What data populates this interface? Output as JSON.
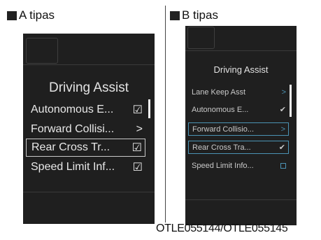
{
  "labels": {
    "a": "A tipas",
    "b": "B tipas"
  },
  "panel_a": {
    "title": "Driving Assist",
    "items": [
      {
        "label": "Autonomous E...",
        "mark": "☑"
      },
      {
        "label": "Forward Collisi...",
        "mark": ">"
      },
      {
        "label": "Rear Cross Tr...",
        "mark": "☑"
      },
      {
        "label": "Speed Limit Inf...",
        "mark": "☑"
      }
    ]
  },
  "panel_b": {
    "title": "Driving Assist",
    "items": [
      {
        "label": "Lane Keep Asst",
        "mark": ">"
      },
      {
        "label": "Autonomous E...",
        "mark": "✔"
      },
      {
        "label": "Forward Collisio...",
        "mark": ">"
      },
      {
        "label": "Rear Cross Tra...",
        "mark": "✔"
      },
      {
        "label": "Speed Limit Info...",
        "mark": ""
      }
    ]
  },
  "caption": "OTLE055144/OTLE055145",
  "colors": {
    "screen": "#1f1f1f",
    "accent_b": "#4b93b4"
  }
}
